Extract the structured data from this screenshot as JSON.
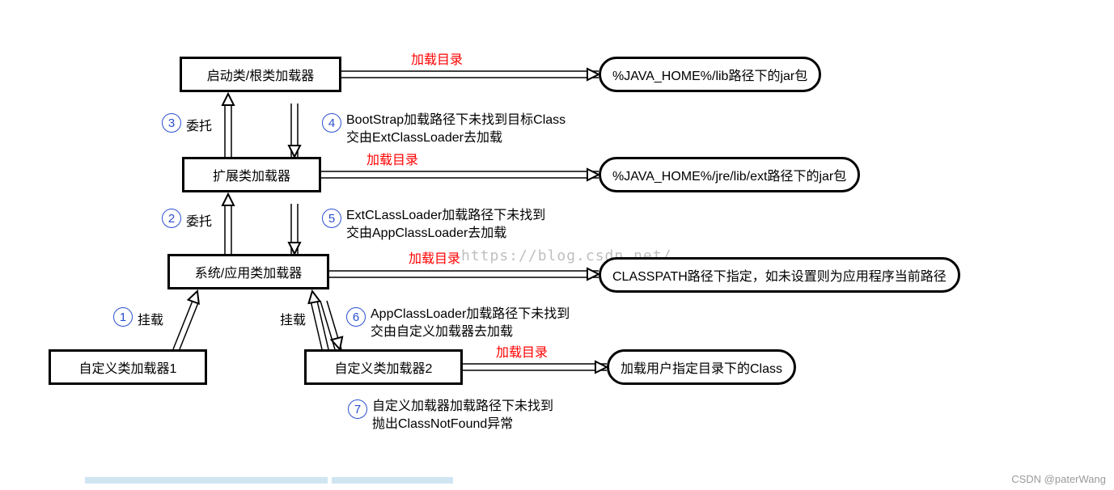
{
  "boxes": {
    "bootstrap": "启动类/根类加载器",
    "ext": "扩展类加载器",
    "app": "系统/应用类加载器",
    "custom1": "自定义类加载器1",
    "custom2": "自定义类加载器2"
  },
  "dirs": {
    "bootstrap": "%JAVA_HOME%/lib路径下的jar包",
    "ext": "%JAVA_HOME%/jre/lib/ext路径下的jar包",
    "app": "CLASSPATH路径下指定，如未设置则为应用程序当前路径",
    "custom": "加载用户指定目录下的Class"
  },
  "loadDirLabel": "加载目录",
  "steps": {
    "n1": "1",
    "l1": "挂载",
    "n2": "2",
    "l2": "委托",
    "n3": "3",
    "l3": "委托",
    "n4": "4",
    "t4a": "BootStrap加载路径下未找到目标Class",
    "t4b": "交由ExtClassLoader去加载",
    "n5": "5",
    "t5a": "ExtCLassLoader加载路径下未找到",
    "t5b": "交由AppClassLoader去加载",
    "n6": "6",
    "l6": "挂载",
    "t6a": "AppClassLoader加载路径下未找到",
    "t6b": "交由自定义加载器去加载",
    "n7": "7",
    "t7a": "自定义加载器加载路径下未找到",
    "t7b": "抛出ClassNotFound异常"
  },
  "watermark": "https://blog.csdn.net/",
  "credit": "CSDN @paterWang"
}
